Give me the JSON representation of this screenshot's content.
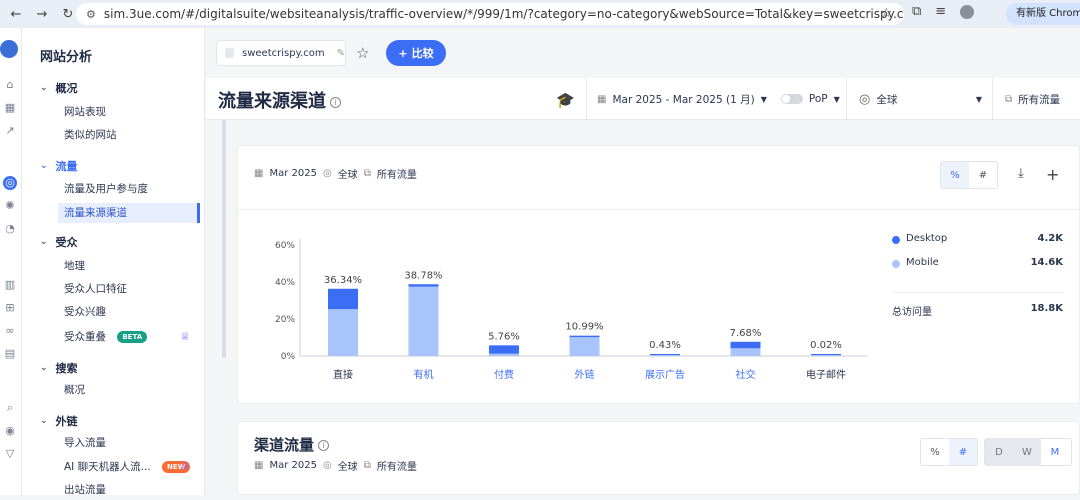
{
  "browser": {
    "url": "sim.3ue.com/#/digitalsuite/websiteanalysis/traffic-overview/*/999/1m/?category=no-category&webSource=Total&key=sweetcrispy.com",
    "update_label": "有新版 Chrome"
  },
  "sidebar": {
    "title": "网站分析",
    "sections": [
      {
        "label": "概况",
        "items": [
          "网站表现",
          "类似的网站"
        ]
      },
      {
        "label": "流量",
        "items": [
          "流量及用户参与度",
          "流量来源渠道"
        ]
      },
      {
        "label": "受众",
        "items": [
          "地理",
          "受众人口特征",
          "受众兴趣",
          "受众重叠"
        ]
      },
      {
        "label": "搜索",
        "items": [
          "概况"
        ]
      },
      {
        "label": "外链",
        "items": [
          "导入流量",
          "AI 聊天机器人流...",
          "出站流量"
        ]
      }
    ],
    "beta_badge": "BETA",
    "new_badge": "NEW"
  },
  "topbar": {
    "site": "sweetcrispy.com",
    "compare_label": "比较"
  },
  "header": {
    "title": "流量来源渠道",
    "date_range": "Mar 2025 - Mar 2025 (1 月)",
    "pop_label": "PoP",
    "geo": "全球",
    "traffic": "所有流量"
  },
  "card1": {
    "date": "Mar 2025",
    "geo": "全球",
    "traffic": "所有流量",
    "pct_toggle": "%",
    "num_toggle": "#",
    "legend": [
      {
        "name": "Desktop",
        "value": "4.2K",
        "color": "#3b6ef5"
      },
      {
        "name": "Mobile",
        "value": "14.6K",
        "color": "#a9c4fb"
      }
    ],
    "total_label": "总访问量",
    "total_value": "18.8K"
  },
  "card2": {
    "title": "渠道流量",
    "date": "Mar 2025",
    "geo": "全球",
    "traffic": "所有流量",
    "pct_toggle": "%",
    "num_toggle": "#",
    "granularity": [
      "D",
      "W",
      "M"
    ]
  },
  "chart_data": {
    "type": "bar",
    "stacked": true,
    "categories": [
      "直接",
      "有机",
      "付费",
      "外链",
      "展示广告",
      "社交",
      "电子邮件"
    ],
    "totals_labels": [
      "36.34%",
      "38.78%",
      "5.76%",
      "10.99%",
      "0.43%",
      "7.68%",
      "0.02%"
    ],
    "series": [
      {
        "name": "Desktop",
        "values": [
          11.0,
          1.3,
          4.5,
          0.8,
          0.1,
          3.5,
          0.01
        ],
        "color": "#3b6ef5"
      },
      {
        "name": "Mobile",
        "values": [
          25.34,
          37.48,
          1.26,
          10.19,
          0.33,
          4.18,
          0.01
        ],
        "color": "#a9c4fb"
      }
    ],
    "yticks": [
      "0%",
      "20%",
      "40%",
      "60%"
    ],
    "ylim": [
      0,
      60
    ],
    "grid": false,
    "legend_placement": "right"
  }
}
